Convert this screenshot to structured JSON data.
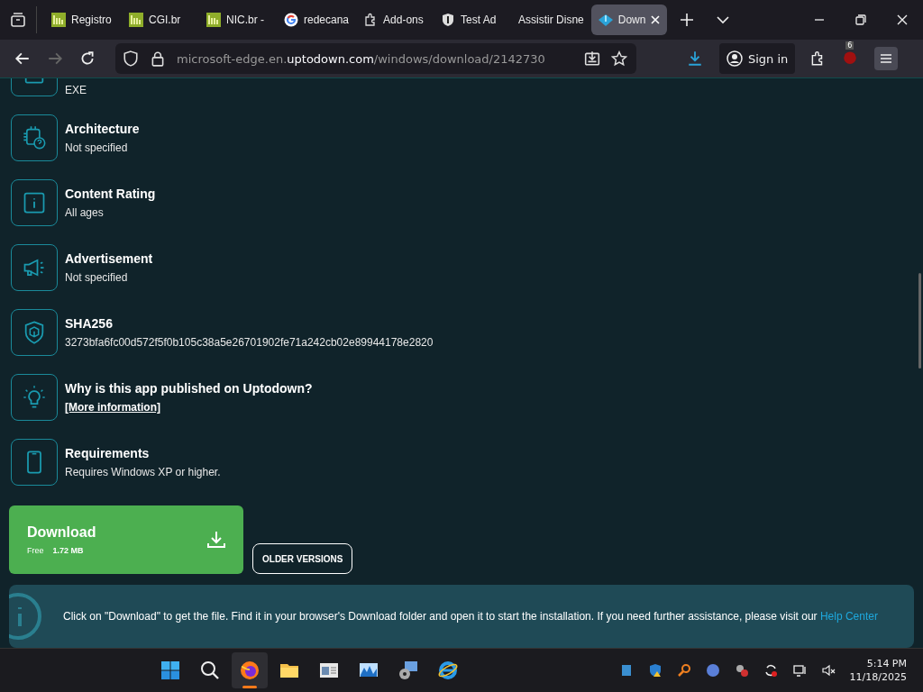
{
  "tabs": [
    {
      "label": "Registro",
      "kind": "br",
      "selected": false
    },
    {
      "label": "CGI.br",
      "kind": "br",
      "selected": false
    },
    {
      "label": "NIC.br -",
      "kind": "br",
      "selected": false
    },
    {
      "label": "redecana",
      "kind": "google",
      "selected": false
    },
    {
      "label": "Add-ons",
      "kind": "addon",
      "selected": false
    },
    {
      "label": "Test Ad",
      "kind": "shield",
      "selected": false
    },
    {
      "label": "Assistir Disne",
      "kind": "plain",
      "selected": false
    },
    {
      "label": "Down",
      "kind": "download",
      "selected": true
    }
  ],
  "address": {
    "url": "microsoft-edge.en.**uptodown.com**/windows/download/2142730"
  },
  "toolbar": {
    "sign_in": "Sign in",
    "extension_badge": "6"
  },
  "details": [
    {
      "kind": "file",
      "value": "EXE"
    },
    {
      "kind": "chip",
      "title": "Architecture",
      "value": "Not specified"
    },
    {
      "kind": "info",
      "title": "Content Rating",
      "value": "All ages"
    },
    {
      "kind": "megaphone",
      "title": "Advertisement",
      "value": "Not specified"
    },
    {
      "kind": "shield",
      "title": "SHA256",
      "value": "3273bfa6fc00d572f5f0b105c38a5e26701902fe71a242cb02e89944178e2820"
    },
    {
      "kind": "bulb",
      "title": "Why is this app published on Uptodown?",
      "link": "[More information]"
    },
    {
      "kind": "phone",
      "title": "Requirements",
      "value": "Requires Windows XP or higher."
    }
  ],
  "download": {
    "title": "Download",
    "price": "Free",
    "size": "1.72 MB"
  },
  "older_versions": "OLDER VERSIONS",
  "notice": {
    "text": "Click on \"Download\" to get the file. Find it in your browser's Download folder and open it to start the installation. If you need further assistance, please visit our",
    "link": "Help Center"
  },
  "taskbar": {
    "apps": [
      {
        "kind": "start",
        "active": false
      },
      {
        "kind": "search",
        "active": false
      },
      {
        "kind": "firefox",
        "active": true
      },
      {
        "kind": "folder",
        "active": false
      },
      {
        "kind": "window",
        "active": false
      },
      {
        "kind": "monitor",
        "active": false
      },
      {
        "kind": "tools",
        "active": false
      },
      {
        "kind": "ie",
        "active": false
      }
    ],
    "time": "5:14 PM",
    "date": "11/18/2025"
  }
}
